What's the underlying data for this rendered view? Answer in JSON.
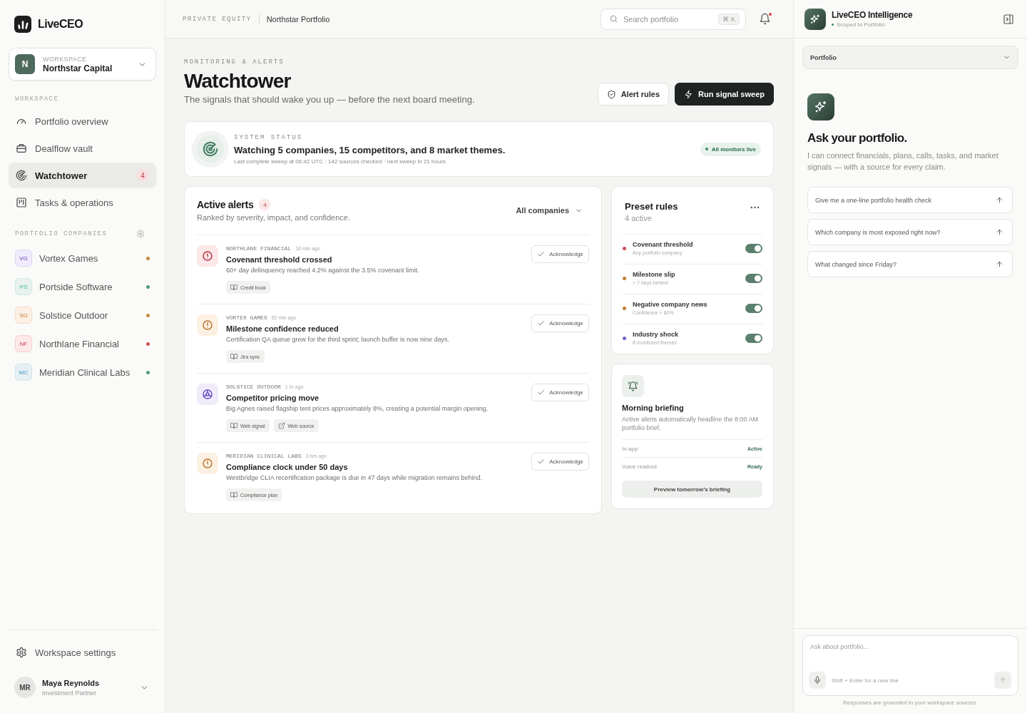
{
  "sidebar": {
    "brand": "LiveCEO",
    "workspace_switcher": {
      "label": "WORKSPACE",
      "initial": "N",
      "name": "Northstar Capital"
    },
    "nav_heading": "WORKSPACE",
    "nav_items": [
      {
        "label": "Portfolio overview",
        "selected": false
      },
      {
        "label": "Dealflow vault",
        "selected": false
      },
      {
        "label": "Watchtower",
        "selected": true,
        "badge": "4"
      },
      {
        "label": "Tasks & operations",
        "selected": false
      }
    ],
    "companies_heading": "PORTFOLIO COMPANIES",
    "companies": [
      {
        "avatar": {
          "initials": "VG",
          "color": "#f1ecfd"
        },
        "name": "Vortex Games",
        "color": "#c98a3e"
      },
      {
        "avatar": {
          "initials": "PS",
          "color": "#e8f1ee"
        },
        "name": "Portside Software",
        "color": "#4f9a7a"
      },
      {
        "avatar": {
          "initials": "SO",
          "color": "#fcefe3"
        },
        "name": "Solstice Outdoor",
        "color": "#c98a3e"
      },
      {
        "avatar": {
          "initials": "NF",
          "color": "#fde8ea"
        },
        "name": "Northlane Financial",
        "color": "#d0525a"
      },
      {
        "avatar": {
          "initials": "MC",
          "color": "#e6eff4"
        },
        "name": "Meridian Clinical Labs",
        "color": "#4f9a7a"
      }
    ],
    "settings_label": "Workspace settings",
    "user": {
      "initials": "MR",
      "name": "Maya Reynolds",
      "role": "Investment Partner"
    }
  },
  "topbar": {
    "section": "PRIVATE EQUITY",
    "title": "Northstar Portfolio",
    "search": {
      "placeholder": "Search portfolio",
      "shortcut": "⌘ K"
    },
    "notifications_unread": true
  },
  "page": {
    "eyebrow": "MONITORING & ALERTS",
    "title": "Watchtower",
    "subtitle": "The signals that should wake you up — before the next board meeting.",
    "buttons": [
      {
        "label": "Alert rules",
        "kind": "secondary"
      },
      {
        "label": "Run signal sweep",
        "kind": "primary"
      }
    ]
  },
  "system_status": {
    "eyebrow": "SYSTEM STATUS",
    "headline": "Watching 5 companies, 15 competitors, and 8 market themes.",
    "detail": "Last complete sweep at 06:42 UTC · 142 sources checked · next sweep in 21 hours",
    "badge": "All monitors live"
  },
  "alerts": {
    "title": "Active alerts",
    "count": "4",
    "subtitle": "Ranked by severity, impact, and confidence.",
    "filter": "All companies",
    "items": [
      {
        "kind": "critical",
        "company": "NORTHLANE FINANCIAL",
        "time": "18 min ago",
        "title": "Covenant threshold crossed",
        "description": "60+ day delinquency reached 4.2% against the 3.5% covenant limit.",
        "action": "Acknowledge",
        "sources": [
          {
            "kind": "doc",
            "label": "Credit book"
          }
        ]
      },
      {
        "kind": "warning",
        "company": "VORTEX GAMES",
        "time": "52 min ago",
        "title": "Milestone confidence reduced",
        "description": "Certification QA queue grew for the third sprint; launch buffer is now nine days.",
        "action": "Acknowledge",
        "sources": [
          {
            "kind": "doc",
            "label": "Jira sync"
          }
        ]
      },
      {
        "kind": "competitor",
        "company": "SOLSTICE OUTDOOR",
        "time": "1 hr ago",
        "title": "Competitor pricing move",
        "description": "Big Agnes raised flagship tent prices approximately 8%, creating a potential margin opening.",
        "action": "Acknowledge",
        "sources": [
          {
            "kind": "doc",
            "label": "Web signal"
          },
          {
            "kind": "link",
            "label": "Web source"
          }
        ]
      },
      {
        "kind": "warning",
        "company": "MERIDIAN CLINICAL LABS",
        "time": "3 hrs ago",
        "title": "Compliance clock under 50 days",
        "description": "Westbridge CLIA recertification package is due in 47 days while migration remains behind.",
        "action": "Acknowledge",
        "sources": [
          {
            "kind": "doc",
            "label": "Compliance plan"
          }
        ]
      }
    ]
  },
  "preset_rules": {
    "title": "Preset rules",
    "subtitle": "4 active",
    "items": [
      {
        "name": "Covenant threshold",
        "detail": "Any portfolio company",
        "color": "#cf4d55",
        "on": true
      },
      {
        "name": "Milestone slip",
        "detail": "> 7 days behind",
        "color": "#c27c33",
        "on": true
      },
      {
        "name": "Negative company news",
        "detail": "Confidence > 80%",
        "color": "#c27c33",
        "on": true
      },
      {
        "name": "Industry shock",
        "detail": "8 monitored themes",
        "color": "#7b5fd1",
        "on": true
      }
    ]
  },
  "briefing": {
    "title": "Morning briefing",
    "description": "Active alerts automatically headline the 8:00 AM portfolio brief.",
    "channels": [
      {
        "name": "In-app",
        "status": "Active"
      },
      {
        "name": "Voice readout",
        "status": "Ready"
      }
    ],
    "button": "Preview tomorrow’s briefing"
  },
  "assistant": {
    "title": "LiveCEO Intelligence",
    "scope": "Scoped to Portfolio",
    "scope_select": "Portfolio",
    "heading": "Ask your portfolio.",
    "intro": "I can connect financials, plans, calls, tasks, and market signals — with a source for every claim.",
    "suggestions": [
      "Give me a one-line portfolio health check",
      "Which company is most exposed right now?",
      "What changed since Friday?"
    ],
    "composer": {
      "placeholder": "Ask about portfolio...",
      "hint": "Shift + Enter for a new line"
    },
    "footer": "Responses are grounded in your workspace sources."
  }
}
